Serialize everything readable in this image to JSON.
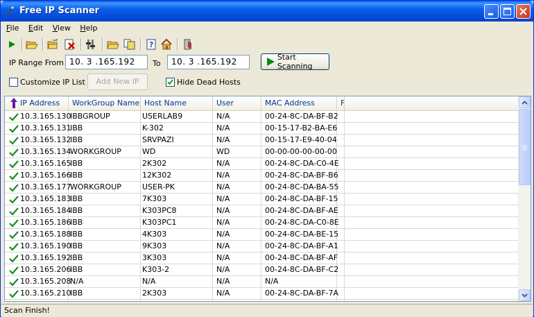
{
  "window": {
    "title": "Free IP Scanner"
  },
  "menu": [
    {
      "hot": "F",
      "rest": "ile"
    },
    {
      "hot": "E",
      "rest": "dit"
    },
    {
      "hot": "V",
      "rest": "iew"
    },
    {
      "hot": "H",
      "rest": "elp"
    }
  ],
  "toolbar": {
    "icons": [
      "play-icon",
      "open-folder-icon",
      "export-icon",
      "delete-icon",
      "columns-icon",
      "folder-icon",
      "document-copy-icon",
      "help-icon",
      "home-icon",
      "exit-icon"
    ]
  },
  "range": {
    "from_label": "IP Range From",
    "from_value": "10. 3 .165.192",
    "to_label": "To",
    "to_value": "10. 3 .165.192"
  },
  "start_button": {
    "label": "Start Scanning"
  },
  "options": {
    "customize_label": "Customize IP List",
    "customize_checked": false,
    "add_ip_label": "Add New IP",
    "hide_dead_label": "Hide Dead Hosts",
    "hide_dead_checked": true
  },
  "columns": [
    "IP Address",
    "WorkGroup Name",
    "Host Name",
    "User",
    "MAC Address",
    "F"
  ],
  "rows": [
    [
      "10.3.165.130",
      "IBBGROUP",
      "USERLAB9",
      "N/A",
      "00-24-8C-DA-BF-B2"
    ],
    [
      "10.3.165.131",
      "IBB",
      "K-302",
      "N/A",
      "00-15-17-B2-BA-E6"
    ],
    [
      "10.3.165.132",
      "IBB",
      "SRVPAZI",
      "N/A",
      "00-15-17-E9-40-04"
    ],
    [
      "10.3.165.134",
      "WORKGROUP",
      "WD",
      "WD",
      "00-00-00-00-00-00"
    ],
    [
      "10.3.165.165",
      "IBB",
      "2K302",
      "N/A",
      "00-24-8C-DA-C0-4E"
    ],
    [
      "10.3.165.166",
      "IBB",
      "12K302",
      "N/A",
      "00-24-8C-DA-BF-B6"
    ],
    [
      "10.3.165.177",
      "WORKGROUP",
      "USER-PK",
      "N/A",
      "00-24-8C-DA-BA-55"
    ],
    [
      "10.3.165.183",
      "IBB",
      "7K303",
      "N/A",
      "00-24-8C-DA-BF-15"
    ],
    [
      "10.3.165.184",
      "IBB",
      "K303PC8",
      "N/A",
      "00-24-8C-DA-BF-AE"
    ],
    [
      "10.3.165.186",
      "IBB",
      "K303PC1",
      "N/A",
      "00-24-8C-DA-C0-8E"
    ],
    [
      "10.3.165.188",
      "IBB",
      "4K303",
      "N/A",
      "00-24-8C-DA-BE-15"
    ],
    [
      "10.3.165.190",
      "IBB",
      "9K303",
      "N/A",
      "00-24-8C-DA-BF-A1"
    ],
    [
      "10.3.165.192",
      "IBB",
      "3K303",
      "N/A",
      "00-24-8C-DA-BF-AF"
    ],
    [
      "10.3.165.206",
      "IBB",
      "K303-2",
      "N/A",
      "00-24-8C-DA-BF-C2"
    ],
    [
      "10.3.165.208",
      "N/A",
      "N/A",
      "N/A",
      "N/A"
    ],
    [
      "10.3.165.210",
      "IBB",
      "2K303",
      "N/A",
      "00-24-8C-DA-BF-7A"
    ]
  ],
  "status": {
    "text": "Scan Finish!"
  }
}
